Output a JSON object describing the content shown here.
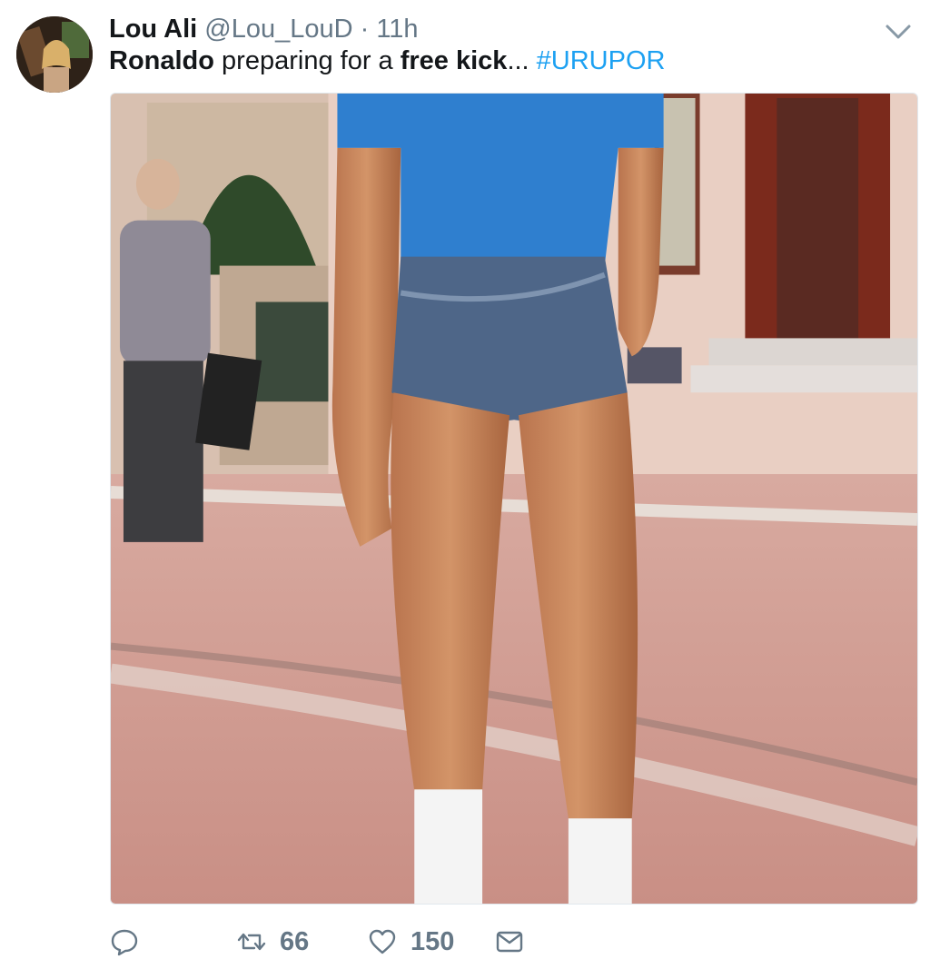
{
  "tweet": {
    "author_name": "Lou Ali",
    "handle": "@Lou_LouD",
    "separator": "·",
    "time": "11h",
    "text_parts": {
      "p1": "Ronaldo",
      "p2": " preparing for a ",
      "p3": "free kick",
      "p4": "... ",
      "hashtag": "#URUPOR"
    }
  },
  "actions": {
    "reply_icon": "reply-bubble-icon",
    "retweet_icon": "retweet-icon",
    "retweet_count": "66",
    "like_icon": "heart-icon",
    "like_count": "150",
    "dm_icon": "envelope-icon"
  },
  "colors": {
    "link": "#1da1f2",
    "muted": "#657786",
    "text": "#14171a"
  }
}
